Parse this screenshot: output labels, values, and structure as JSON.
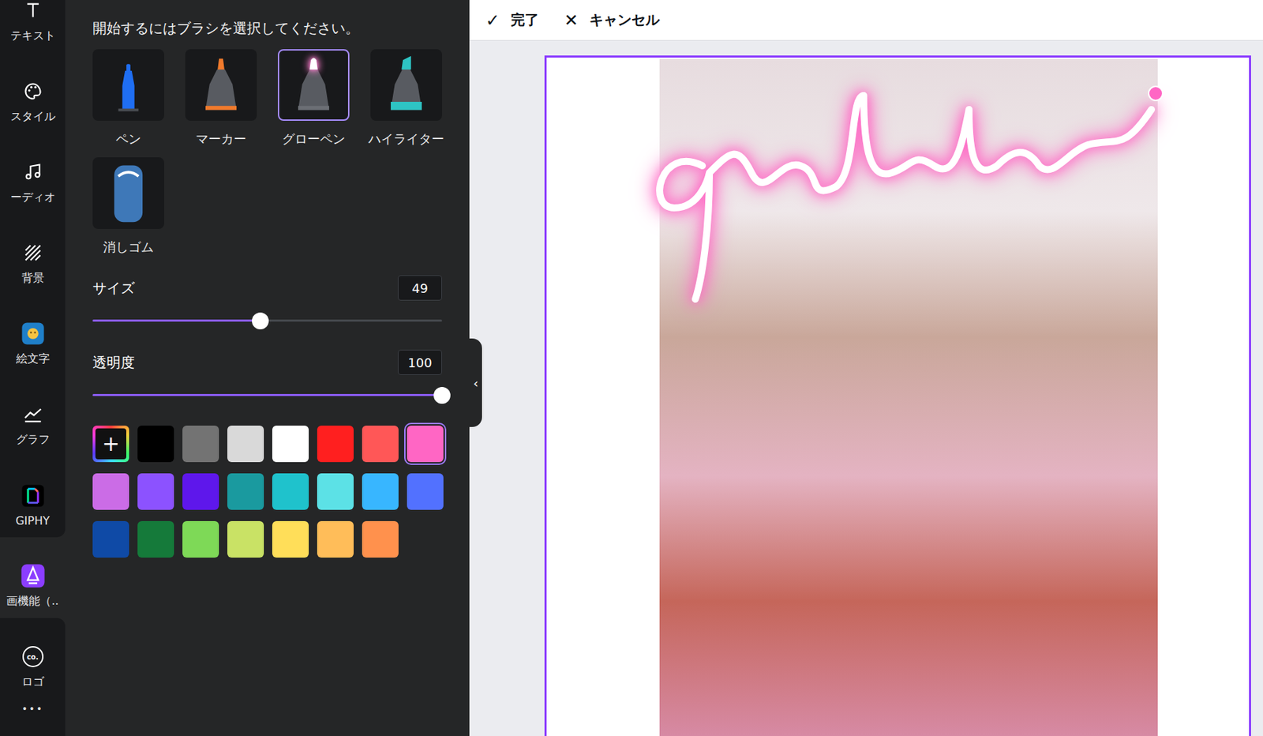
{
  "rail": {
    "items": [
      {
        "label": "テキスト",
        "selected": false
      },
      {
        "label": "スタイル",
        "selected": false
      },
      {
        "label": "ーディオ",
        "selected": false
      },
      {
        "label": "背景",
        "selected": false
      },
      {
        "label": "絵文字",
        "selected": false
      },
      {
        "label": "グラフ",
        "selected": false
      },
      {
        "label": "GIPHY",
        "selected": false
      },
      {
        "label": "画機能（..",
        "selected": true
      },
      {
        "label": "ロゴ",
        "selected": false,
        "badge": "co."
      }
    ],
    "more": "•••"
  },
  "panel": {
    "title": "開始するにはブラシを選択してください。",
    "brushes": [
      {
        "label": "ペン",
        "kind": "pen",
        "selected": false,
        "color": "#1f6ef2"
      },
      {
        "label": "マーカー",
        "kind": "marker",
        "selected": false,
        "color": "#f07a2c"
      },
      {
        "label": "グローペン",
        "kind": "glow",
        "selected": true,
        "color": "#ff7fd0"
      },
      {
        "label": "ハイライター",
        "kind": "highlighter",
        "selected": false,
        "color": "#2ec4c4"
      },
      {
        "label": "消しゴム",
        "kind": "eraser",
        "selected": false,
        "color": "#3e78b8"
      }
    ],
    "size": {
      "label": "サイズ",
      "value": "49",
      "level": 0.48
    },
    "opacity": {
      "label": "透明度",
      "value": "100",
      "level": 1
    },
    "add_color": "+",
    "colors": [
      {
        "color": "#000000",
        "selected": false
      },
      {
        "color": "#737373",
        "selected": false
      },
      {
        "color": "#d9d9d9",
        "selected": false
      },
      {
        "color": "#ffffff",
        "selected": false
      },
      {
        "color": "#ff1f1f",
        "selected": false
      },
      {
        "color": "#ff5757",
        "selected": false
      },
      {
        "color": "#ff66c4",
        "selected": true
      },
      {
        "color": "#cb6ce6",
        "selected": false
      },
      {
        "color": "#8c52ff",
        "selected": false
      },
      {
        "color": "#5e17eb",
        "selected": false
      },
      {
        "color": "#1a9a9f",
        "selected": false
      },
      {
        "color": "#1fc2cc",
        "selected": false
      },
      {
        "color": "#5ce1e6",
        "selected": false
      },
      {
        "color": "#38b6ff",
        "selected": false
      },
      {
        "color": "#5271ff",
        "selected": false
      },
      {
        "color": "#0f4aa6",
        "selected": false
      },
      {
        "color": "#157a3a",
        "selected": false
      },
      {
        "color": "#7ed957",
        "selected": false
      },
      {
        "color": "#c9e265",
        "selected": false
      },
      {
        "color": "#ffde59",
        "selected": false
      },
      {
        "color": "#ffbd59",
        "selected": false
      },
      {
        "color": "#ff914d",
        "selected": false
      }
    ]
  },
  "collapse": "‹",
  "toolbar": {
    "done_icon": "✓",
    "done": "完了",
    "cancel_icon": "✕",
    "cancel": "キャンセル"
  }
}
